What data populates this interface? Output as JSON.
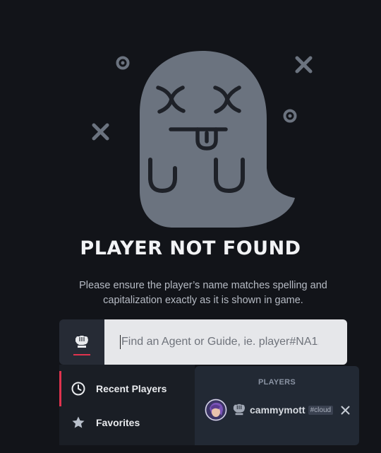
{
  "empty_state": {
    "title": "PLAYER NOT FOUND",
    "message": "Please ensure the player’s name matches spelling and capitalization exactly as it is shown in game."
  },
  "search": {
    "platform_icon": "riot-fist-icon",
    "placeholder": "Find an Agent or Guide, ie. player#NA1, e",
    "value": ""
  },
  "dropdown": {
    "nav": [
      {
        "label": "Recent Players",
        "icon": "clock-icon",
        "active": true
      },
      {
        "label": "Favorites",
        "icon": "star-icon",
        "active": false
      }
    ],
    "section_label": "PLAYERS",
    "players": [
      {
        "name": "cammymott",
        "tag": "#cloud",
        "platform_icon": "riot-fist-icon"
      }
    ]
  },
  "colors": {
    "background": "#121419",
    "accent": "#e0334e",
    "ghost": "#6b737f",
    "ghost_features": "#1e2128"
  }
}
